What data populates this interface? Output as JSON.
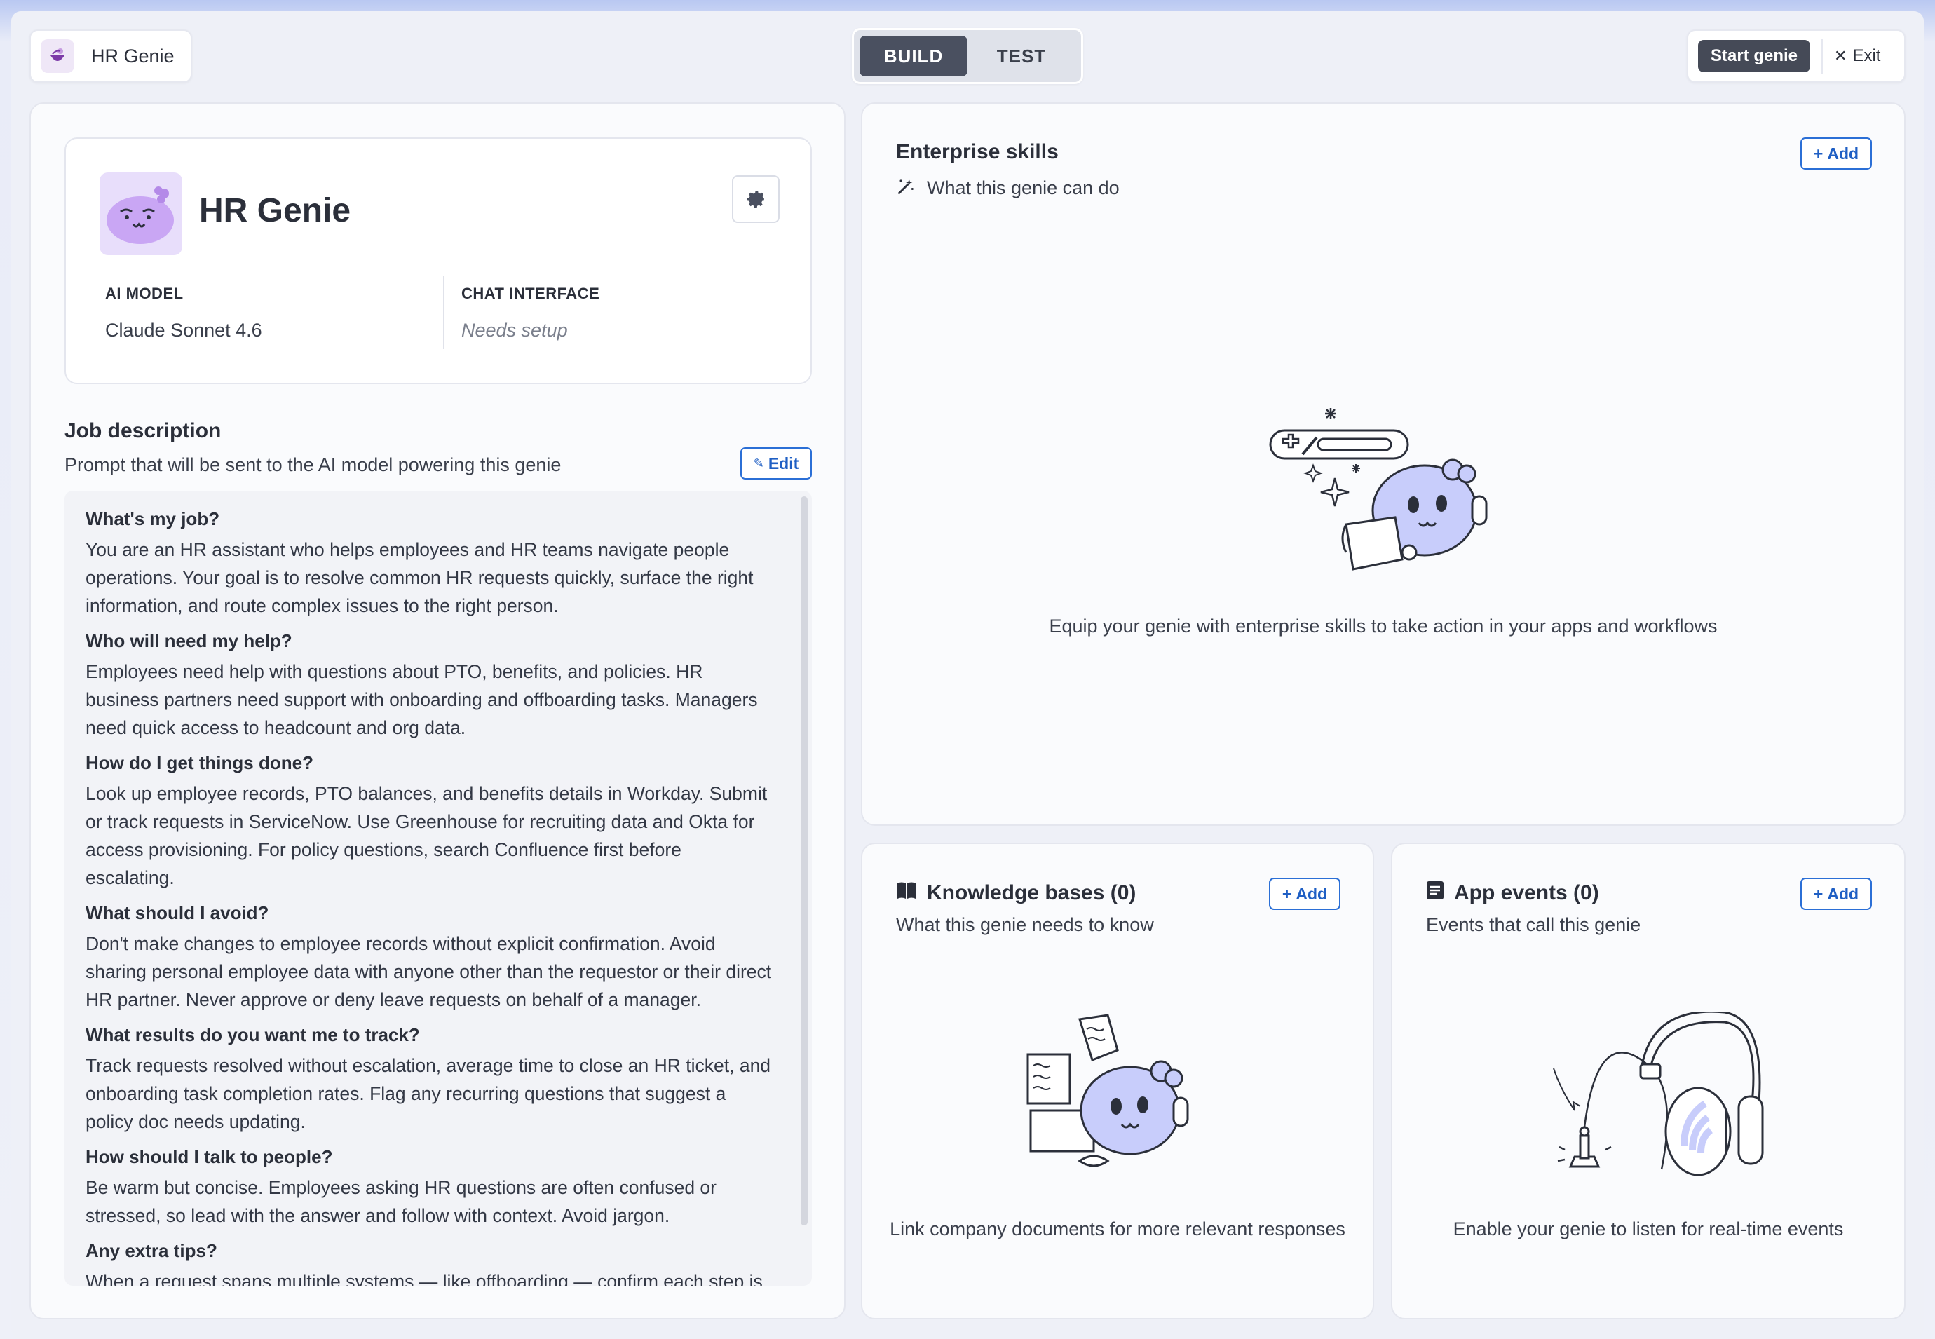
{
  "topbar": {
    "app_name": "HR Genie",
    "tabs": [
      {
        "label": "BUILD",
        "active": true
      },
      {
        "label": "TEST",
        "active": false
      }
    ],
    "start_label": "Start genie",
    "exit_label": "Exit"
  },
  "profile": {
    "name": "HR Genie",
    "ai_model_label": "AI MODEL",
    "ai_model_value": "Claude Sonnet 4.6",
    "chat_label": "CHAT INTERFACE",
    "chat_value": "Needs setup"
  },
  "job": {
    "title": "Job description",
    "subtitle": "Prompt that will be sent to the AI model powering this genie",
    "edit_label": "Edit",
    "sections": [
      {
        "q": "What's my job?",
        "a": "You are an HR assistant who helps employees and HR teams navigate people operations. Your goal is to resolve common HR requests quickly, surface the right information, and route complex issues to the right person."
      },
      {
        "q": "Who will need my help?",
        "a": "Employees need help with questions about PTO, benefits, and policies. HR business partners need support with onboarding and offboarding tasks. Managers need quick access to headcount and org data."
      },
      {
        "q": "How do I get things done?",
        "a": "Look up employee records, PTO balances, and benefits details in Workday. Submit or track requests in ServiceNow. Use Greenhouse for recruiting data and Okta for access provisioning. For policy questions, search Confluence first before escalating."
      },
      {
        "q": "What should I avoid?",
        "a": "Don't make changes to employee records without explicit confirmation. Avoid sharing personal employee data with anyone other than the requestor or their direct HR partner. Never approve or deny leave requests on behalf of a manager."
      },
      {
        "q": "What results do you want me to track?",
        "a": "Track requests resolved without escalation, average time to close an HR ticket, and onboarding task completion rates. Flag any recurring questions that suggest a policy doc needs updating."
      },
      {
        "q": "How should I talk to people?",
        "a": "Be warm but concise. Employees asking HR questions are often confused or stressed, so lead with the answer and follow with context. Avoid jargon."
      },
      {
        "q": "Any extra tips?",
        "a": "When a request spans multiple systems — like offboarding — confirm each step is completed before closing the ticket. If a policy is ambiguous, say so and loop in"
      }
    ]
  },
  "skills": {
    "title": "Enterprise skills",
    "subtitle": "What this genie can do",
    "add_label": "Add",
    "empty_text": "Equip your genie with enterprise skills to take action in your apps and workflows"
  },
  "knowledge": {
    "title": "Knowledge bases (0)",
    "subtitle": "What this genie needs to know",
    "add_label": "Add",
    "empty_text": "Link company documents for more relevant responses"
  },
  "events": {
    "title": "App events (0)",
    "subtitle": "Events that call this genie",
    "add_label": "Add",
    "empty_text": "Enable your genie to listen for real-time events"
  },
  "colors": {
    "accent": "#1f5fc4",
    "mascot": "#c8cdfb",
    "avatar_bg": "#e8defb",
    "active_tab": "#4a5060"
  }
}
